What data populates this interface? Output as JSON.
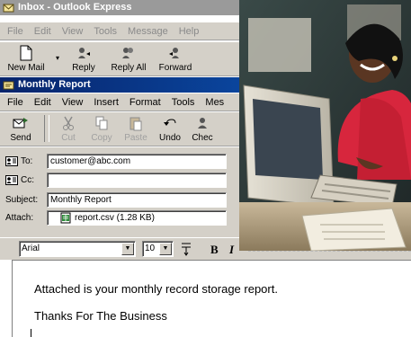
{
  "outer_window": {
    "title": "Inbox - Outlook Express",
    "menu": [
      "File",
      "Edit",
      "View",
      "Tools",
      "Message",
      "Help"
    ],
    "toolbar": [
      "New Mail",
      "Reply",
      "Reply All",
      "Forward"
    ]
  },
  "compose_window": {
    "title": "Monthly Report",
    "menu": [
      "File",
      "Edit",
      "View",
      "Insert",
      "Format",
      "Tools",
      "Mes"
    ],
    "toolbar": {
      "send": "Send",
      "cut": "Cut",
      "copy": "Copy",
      "paste": "Paste",
      "undo": "Undo",
      "check": "Chec"
    },
    "header": {
      "to_label": "To:",
      "to_value": "customer@abc.com",
      "cc_label": "Cc:",
      "cc_value": "",
      "subject_label": "Subject:",
      "subject_value": "Monthly Report",
      "attach_label": "Attach:",
      "attach_value": "report.csv (1.28 KB)"
    },
    "format_bar": {
      "font": "Arial",
      "size": "10",
      "bold": "B",
      "italic": "I"
    },
    "body": {
      "line1": "Attached is your monthly record storage report.",
      "line2": "Thanks For The Business"
    }
  },
  "colors": {
    "active_title": "#0a246a",
    "inactive_title": "#9a9a9a",
    "chrome": "#d4d0c8"
  }
}
